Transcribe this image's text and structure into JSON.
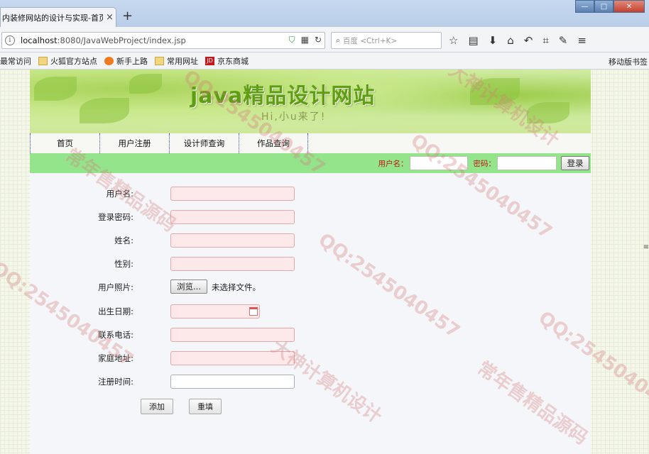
{
  "browser": {
    "tab_title": "内装修网站的设计与实现-首页",
    "tab_close": "×",
    "new_tab": "+",
    "window_buttons": [
      "—",
      "□",
      "✕"
    ],
    "url_host": "localhost",
    "url_path": ":8080/JavaWebProject/index.jsp",
    "search_placeholder": "百度 <Ctrl+K>",
    "toolbar_icons": [
      "star-icon",
      "reader-icon",
      "download-icon",
      "home-icon",
      "undo-icon",
      "crop-icon",
      "extensions-icon",
      "menu-icon"
    ],
    "bookmarks": [
      {
        "label": "最常访问",
        "icon": "none"
      },
      {
        "label": "火狐官方站点",
        "icon": "folder"
      },
      {
        "label": "新手上路",
        "icon": "fox"
      },
      {
        "label": "常用网址",
        "icon": "folder"
      },
      {
        "label": "京东商城",
        "icon": "jd"
      }
    ],
    "jd_badge": "JD",
    "mobile_bookmarks": "移动版书签"
  },
  "site": {
    "banner_title": "java精品设计网站",
    "banner_subtitle": "Hi,小u来了!",
    "menu": [
      "首页",
      "用户注册",
      "设计师查询",
      "作品查询"
    ],
    "login": {
      "username_label": "用户名：",
      "password_label": "密码：",
      "button": "登录"
    }
  },
  "form": {
    "fields": [
      {
        "label": "用户名:",
        "type": "text"
      },
      {
        "label": "登录密码:",
        "type": "text"
      },
      {
        "label": "姓名:",
        "type": "text"
      },
      {
        "label": "性别:",
        "type": "text"
      },
      {
        "label": "用户照片:",
        "type": "file"
      },
      {
        "label": "出生日期:",
        "type": "date"
      },
      {
        "label": "联系电话:",
        "type": "text"
      },
      {
        "label": "家庭地址:",
        "type": "text"
      },
      {
        "label": "注册时间:",
        "type": "plain"
      }
    ],
    "file_button": "浏览...",
    "file_status": "未选择文件。",
    "add_button": "添加",
    "reset_button": "重填"
  },
  "watermarks": [
    "QQ:2545040457",
    "大神计算机设计",
    "常年售精品源码"
  ],
  "colors": {
    "login_bar": "#94e48c",
    "login_label": "#c01818",
    "required_field_bg": "#fde9ea",
    "banner_title": "#5f9e12"
  }
}
